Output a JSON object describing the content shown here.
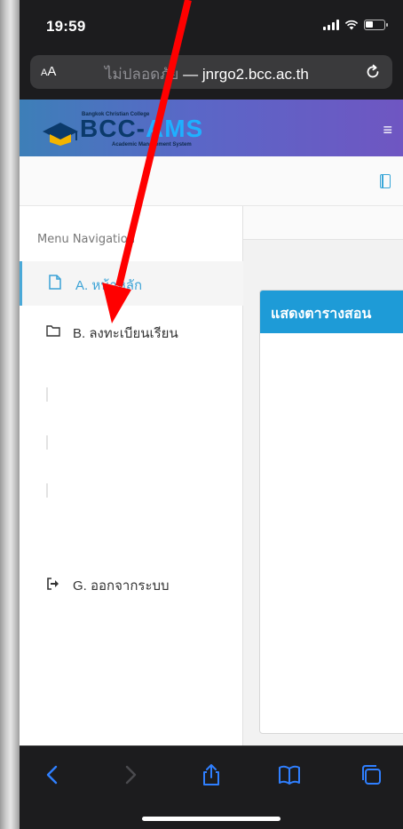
{
  "status_bar": {
    "time": "19:59",
    "signal_icon": "signal-icon",
    "wifi_icon": "wifi-icon",
    "battery_icon": "battery-icon"
  },
  "url_bar": {
    "text_size_label": "AA",
    "security_text": "ไม่ปลอดภัย",
    "separator": " — ",
    "domain": "jnrgo2.bcc.ac.th",
    "reload_icon": "reload-icon"
  },
  "site": {
    "logo_top": "Bangkok Christian College",
    "logo_name_a": "BCC-",
    "logo_name_b": "AMS",
    "logo_sub": "Academic Management System",
    "menu_icon": "≡",
    "brand_colors": {
      "header_start": "#3d7fb8",
      "header_end": "#6f56c2",
      "accent": "#1e9bd7"
    }
  },
  "sidebar": {
    "header": "Menu Navigation",
    "items": [
      {
        "label": "A. หน้าหลัก",
        "icon": "file-icon",
        "active": true
      },
      {
        "label": "B. ลงทะเบียนเรียน",
        "icon": "folder-icon",
        "active": false
      },
      {
        "label": "G. ออกจากระบบ",
        "icon": "logout-icon",
        "active": false
      }
    ]
  },
  "main": {
    "card_title": "แสดงตารางสอน"
  },
  "annotation": {
    "type": "red-arrow",
    "color": "#ff0000"
  },
  "toolbar": {
    "items": [
      "back-icon",
      "forward-icon",
      "share-icon",
      "bookmarks-icon",
      "tabs-icon"
    ]
  }
}
